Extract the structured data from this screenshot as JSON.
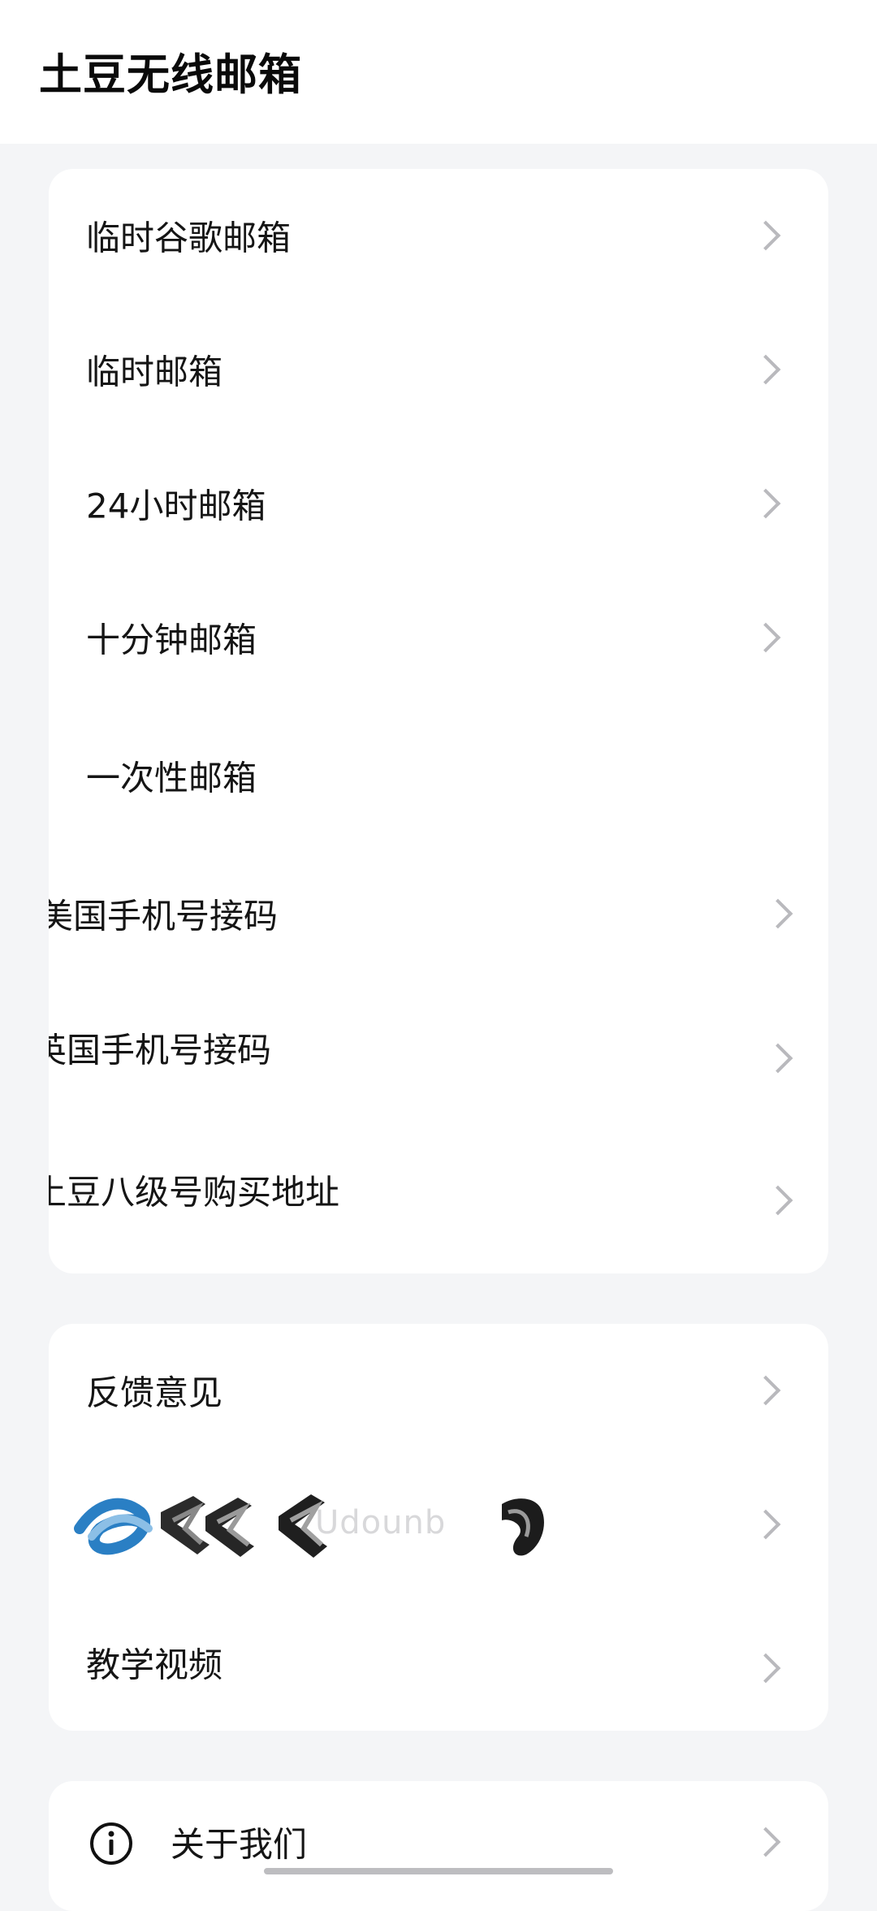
{
  "header": {
    "title": "土豆无线邮箱"
  },
  "group1": {
    "items": [
      {
        "label": "临时谷歌邮箱"
      },
      {
        "label": "临时邮箱"
      },
      {
        "label": "24小时邮箱"
      },
      {
        "label": "十分钟邮箱"
      },
      {
        "label": "一次性邮箱"
      },
      {
        "label": "美国手机号接码"
      },
      {
        "label": "英国手机号接码"
      },
      {
        "label": "土豆八级号购买地址"
      }
    ]
  },
  "group2": {
    "items": [
      {
        "label": "反馈意见"
      },
      {
        "label": "Udounb"
      },
      {
        "label": "教学视频"
      }
    ]
  },
  "group3": {
    "items": [
      {
        "label": "关于我们",
        "icon": "info-icon"
      }
    ]
  },
  "colors": {
    "background": "#f4f5f7",
    "card": "#ffffff",
    "chevron": "#b9b9bd"
  }
}
